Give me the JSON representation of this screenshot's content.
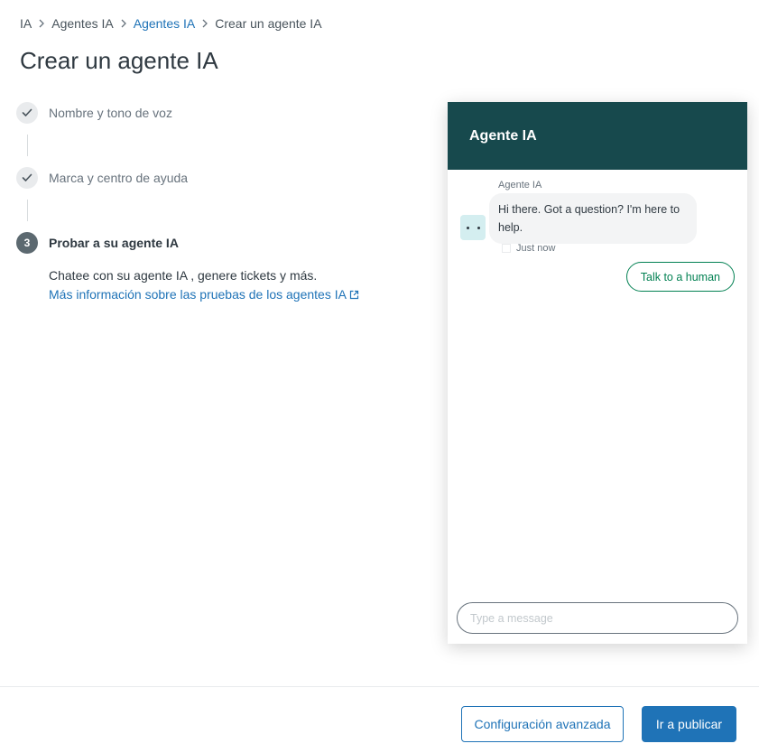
{
  "breadcrumb": {
    "items": [
      "IA",
      "Agentes IA",
      "Agentes IA",
      "Crear un agente IA"
    ]
  },
  "page": {
    "title": "Crear un agente IA"
  },
  "stepper": {
    "steps": [
      {
        "label": "Nombre y tono de voz",
        "state": "completed"
      },
      {
        "label": "Marca y centro de ayuda",
        "state": "completed"
      },
      {
        "label": "Probar a su agente IA",
        "state": "active",
        "number": "3"
      }
    ],
    "active_description": "Chatee con su agente IA , genere tickets y más.",
    "active_link": "Más información sobre las pruebas de los agentes IA"
  },
  "widget": {
    "title": "Agente IA",
    "message": {
      "sender": "Agente IA",
      "text": "Hi there. Got a question? I'm here to help.",
      "time": "Just now"
    },
    "human_button": "Talk to a human",
    "composer_placeholder": "Type a message"
  },
  "footer": {
    "secondary_button": "Configuración avanzada",
    "primary_button": "Ir a publicar"
  },
  "colors": {
    "header_bg": "#17494d",
    "primary": "#1f73b7",
    "success_green": "#038153"
  }
}
